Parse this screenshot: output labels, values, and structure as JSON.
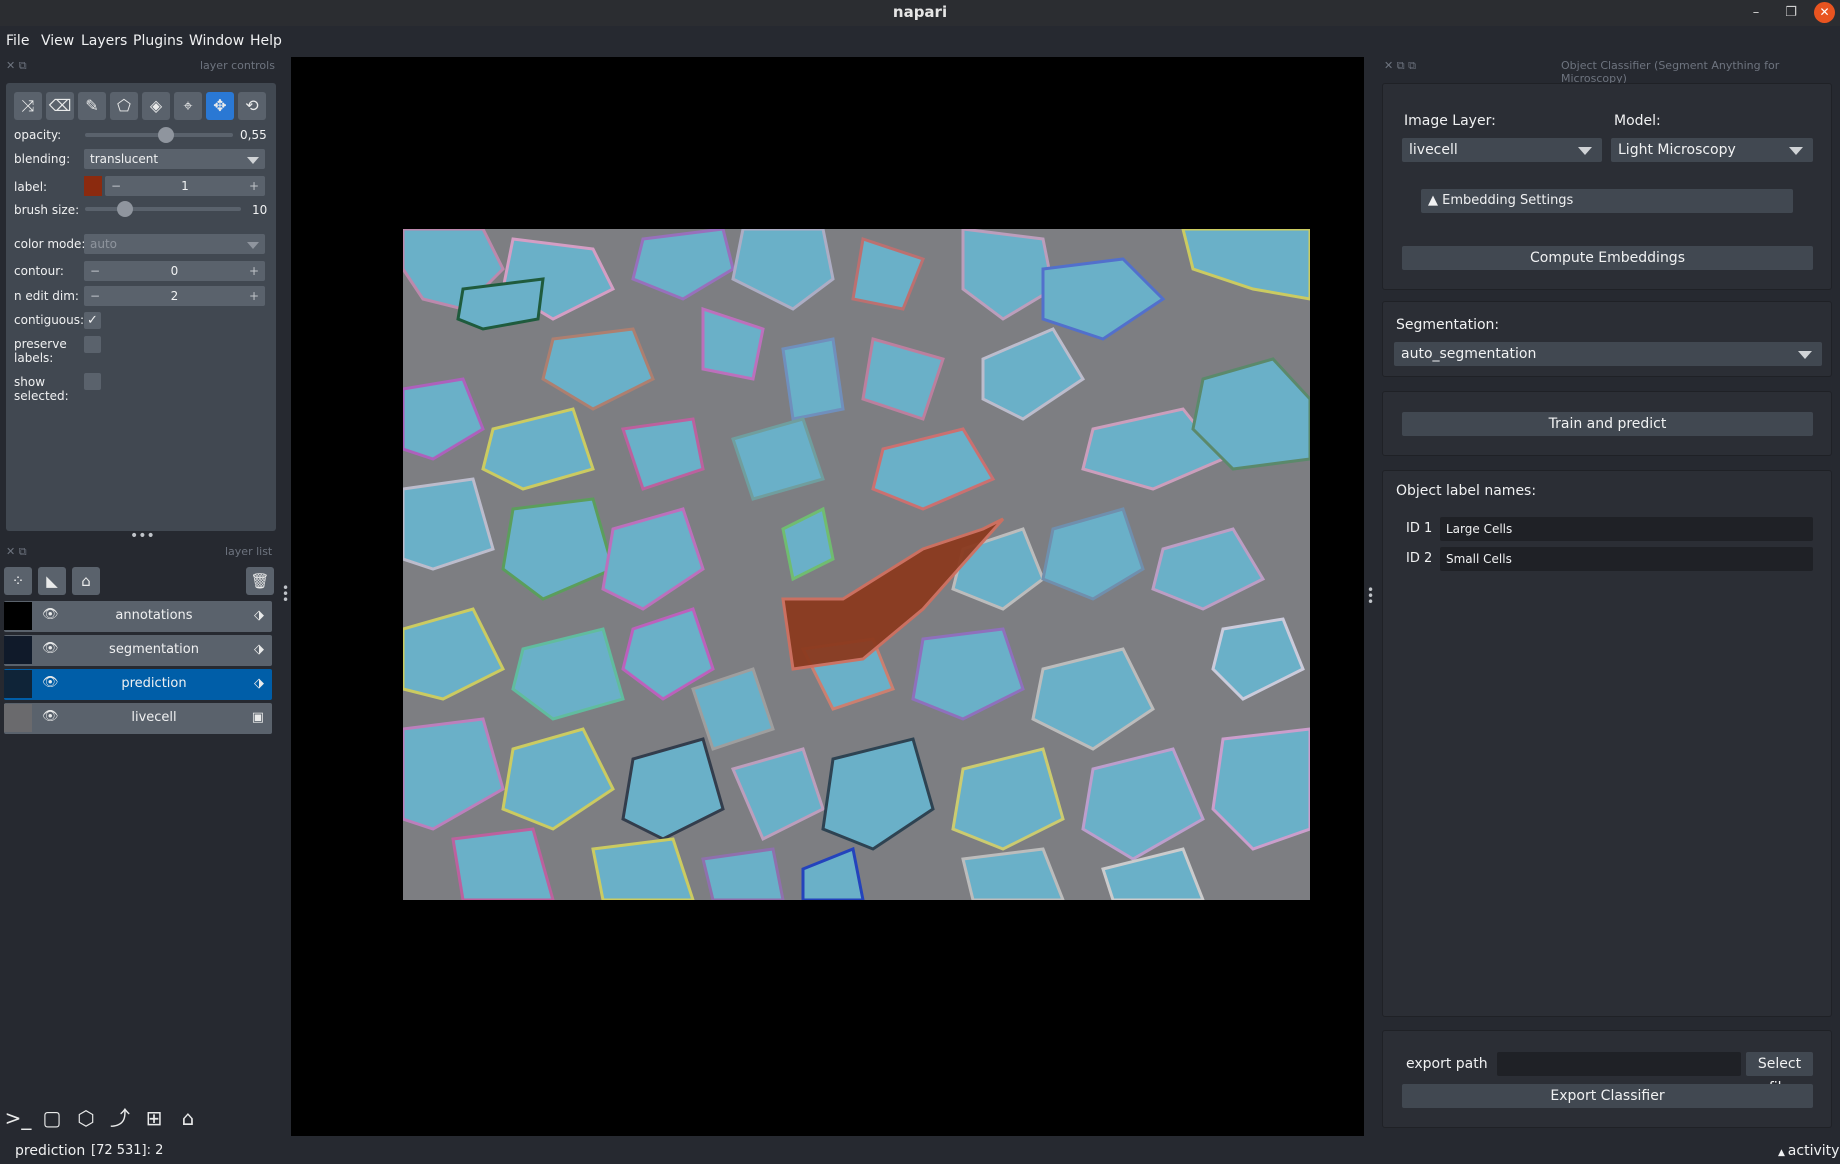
{
  "window": {
    "title": "napari"
  },
  "menu": [
    "File",
    "View",
    "Layers",
    "Plugins",
    "Window",
    "Help"
  ],
  "layer_controls": {
    "header": "layer controls",
    "opacity_label": "opacity:",
    "opacity_value": "0,55",
    "opacity_level": 0.55,
    "blending_label": "blending:",
    "blending_value": "translucent",
    "label_label": "label:",
    "label_value": "1",
    "label_color": "#8b2a0e",
    "brush_size_label": "brush size:",
    "brush_size_value": "10",
    "color_mode_label": "color mode:",
    "color_mode_value": "auto",
    "contour_label": "contour:",
    "contour_value": "0",
    "n_edit_dim_label": "n edit dim:",
    "n_edit_dim_value": "2",
    "contiguous_label": "contiguous:",
    "contiguous_checked": true,
    "preserve_labels_label_1": "preserve",
    "preserve_labels_label_2": "labels:",
    "show_selected_label_1": "show",
    "show_selected_label_2": "selected:"
  },
  "layer_list": {
    "header": "layer list",
    "layers": [
      {
        "name": "annotations",
        "type_icon": "tag-icon"
      },
      {
        "name": "segmentation",
        "type_icon": "tag-icon"
      },
      {
        "name": "prediction",
        "type_icon": "tag-icon",
        "selected": true
      },
      {
        "name": "livecell",
        "type_icon": "image-icon"
      }
    ]
  },
  "plugin": {
    "title": "Object Classifier (Segment Anything for Microscopy)",
    "image_layer_label": "Image Layer:",
    "image_layer_value": "livecell",
    "model_label": "Model:",
    "model_value": "Light Microscopy",
    "embedding_settings": "Embedding Settings",
    "compute_embeddings": "Compute Embeddings",
    "segmentation_label": "Segmentation:",
    "segmentation_value": "auto_segmentation",
    "train_predict": "Train and predict",
    "object_label_names": "Object label names:",
    "labels": [
      {
        "id": "ID 1",
        "name": "Large Cells"
      },
      {
        "id": "ID 2",
        "name": "Small Cells"
      }
    ],
    "export_path_label": "export path",
    "export_path_value": "",
    "select_file": "Select file",
    "export_classifier": "Export Classifier"
  },
  "status": {
    "layer": "prediction",
    "coords": "[72 531]: 2",
    "activity": "activity"
  },
  "colors": {
    "accent": "#2a78d4",
    "selected_layer": "#005ea8",
    "cell_fill": "#6ab3cc",
    "cell_highlight": "#8b3a1e"
  }
}
